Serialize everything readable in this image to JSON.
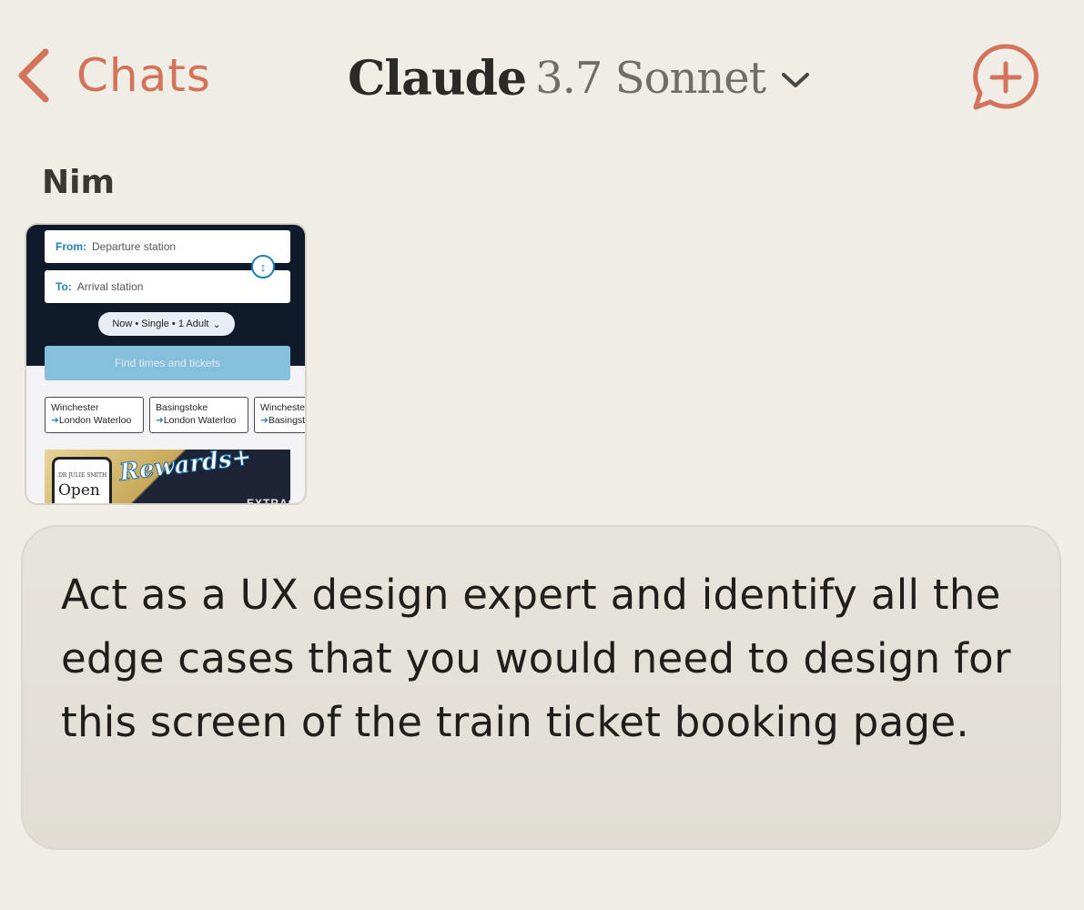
{
  "header": {
    "back_label": "Chats",
    "title_main": "Claude",
    "title_model": "3.7 Sonnet",
    "accent_color": "#d2735a"
  },
  "message": {
    "sender": "Nim",
    "text": "Act as a UX design expert and identify all the edge cases that you would need to design for this screen of the train ticket booking page."
  },
  "attachment": {
    "from_label": "From:",
    "from_placeholder": "Departure station",
    "to_label": "To:",
    "to_placeholder": "Arrival station",
    "options_pill": "Now • Single • 1 Adult",
    "find_button": "Find times and tickets",
    "routes": [
      {
        "from": "Winchester",
        "to": "London Waterloo"
      },
      {
        "from": "Basingstoke",
        "to": "London Waterloo"
      },
      {
        "from": "Winchester",
        "to": "Basingstoke"
      }
    ],
    "banner": {
      "rewards": "Rewards+",
      "phone_small": "DR JULIE SMITH",
      "phone_big": "Open",
      "tail": "EXTRACT"
    }
  },
  "icons": {
    "back": "chevron-left-icon",
    "model_menu": "chevron-down-icon",
    "new_chat": "new-chat-icon"
  }
}
